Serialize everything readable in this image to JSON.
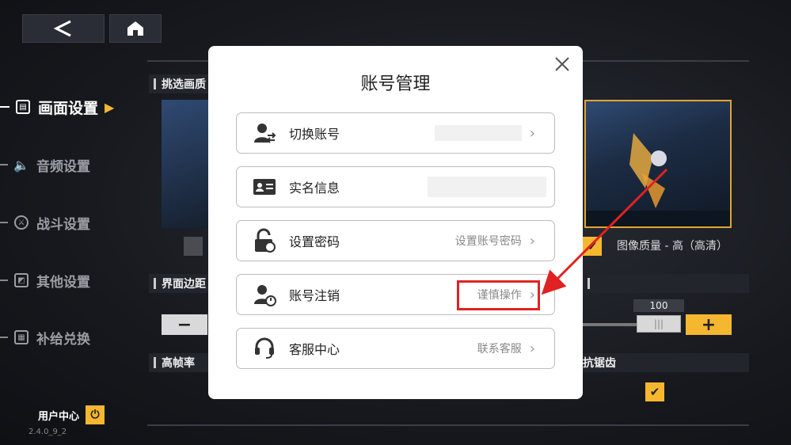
{
  "nav": {
    "back_icon": "chevron-left-icon",
    "home_icon": "home-icon"
  },
  "sidebar": {
    "items": [
      {
        "label": "画面设置",
        "icon": "screen-icon",
        "active": true
      },
      {
        "label": "音频设置",
        "icon": "speaker-icon",
        "active": false
      },
      {
        "label": "战斗设置",
        "icon": "combat-icon",
        "active": false
      },
      {
        "label": "其他设置",
        "icon": "misc-icon",
        "active": false
      },
      {
        "label": "补给兑换",
        "icon": "gift-icon",
        "active": false
      }
    ],
    "user_center_label": "用户中心",
    "version": "2.4.0_9_2"
  },
  "settings": {
    "section1_label": "挑选画质",
    "section2_label": "界面边距",
    "section3_label": "高帧率",
    "section4_label": "抗锯齿",
    "quality_label": "图像质量 - 高（高清）",
    "margin_value": "100",
    "minus_label": "−",
    "plus_label": "+"
  },
  "modal": {
    "title": "账号管理",
    "close_icon": "close-icon",
    "rows": [
      {
        "label": "切换账号",
        "value": "",
        "icon": "switch-account-icon"
      },
      {
        "label": "实名信息",
        "value": "",
        "icon": "id-card-icon"
      },
      {
        "label": "设置密码",
        "value": "设置账号密码",
        "icon": "lock-icon"
      },
      {
        "label": "账号注销",
        "value": "谨慎操作",
        "icon": "account-logout-icon"
      },
      {
        "label": "客服中心",
        "value": "联系客服",
        "icon": "headset-icon"
      }
    ]
  },
  "colors": {
    "accent": "#f5b730",
    "highlight": "#e02222"
  }
}
